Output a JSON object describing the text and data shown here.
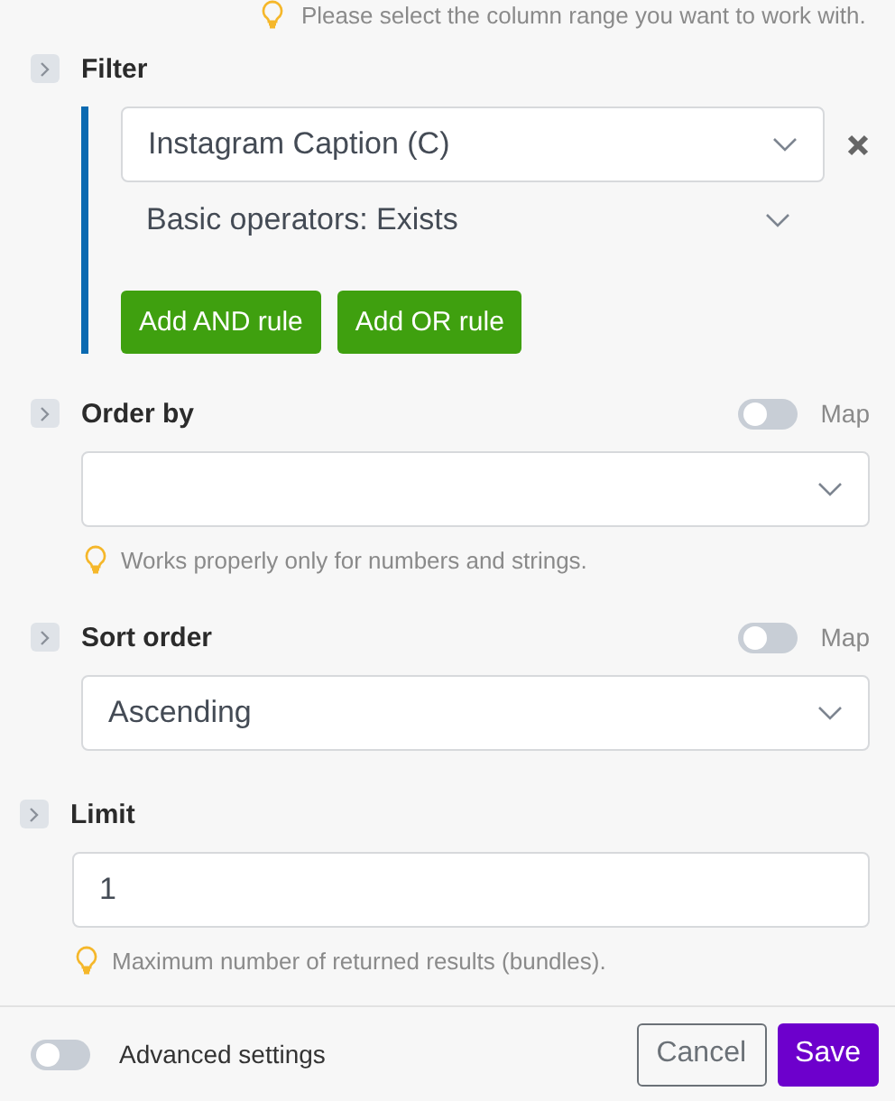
{
  "top_hint": "Please select the column range you want to work with.",
  "filter": {
    "title": "Filter",
    "column": "Instagram Caption (C)",
    "operator": "Basic operators: Exists",
    "buttons": [
      "Add AND rule",
      "Add OR rule"
    ]
  },
  "sections": [
    {
      "kind": "select",
      "title": "Order by",
      "map": {
        "label": "Map",
        "on": false
      },
      "hint": "Works properly only for numbers and strings."
    },
    {
      "kind": "select",
      "title": "Sort order",
      "map": {
        "label": "Map",
        "on": false
      },
      "value": "Ascending"
    },
    {
      "kind": "input",
      "title": "Limit",
      "value": "1",
      "hint": "Maximum number of returned results (bundles)."
    }
  ],
  "footer": {
    "advanced": {
      "label": "Advanced settings",
      "on": false
    },
    "cancel": "Cancel",
    "save": "Save"
  }
}
